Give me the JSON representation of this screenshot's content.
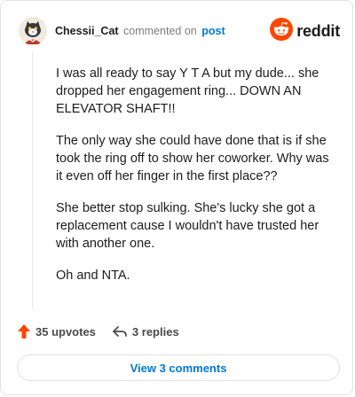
{
  "header": {
    "username": "Chessii_Cat",
    "action_text": "commented on",
    "post_link": "post",
    "brand_name": "reddit",
    "brand_color": "#ff4500",
    "avatar_icon": "cat-avatar-icon"
  },
  "comment": {
    "paragraphs": [
      "I was all ready to say Y T A but my dude... she dropped her engagement ring... DOWN AN ELEVATOR SHAFT!!",
      "The only way she could have done that is if she took the ring off to show her coworker. Why was it even off her finger in the first place??",
      "She better stop sulking. She's lucky she got a replacement cause I wouldn't have trusted her with another one.",
      "Oh and NTA."
    ]
  },
  "footer": {
    "upvotes": "35 upvotes",
    "replies": "3 replies",
    "upvote_icon": "upvote-arrow-icon",
    "reply_icon": "reply-arrow-icon",
    "upvote_color": "#ff4500"
  },
  "actions": {
    "view_comments_label": "View 3 comments",
    "link_color": "#0079d3"
  }
}
